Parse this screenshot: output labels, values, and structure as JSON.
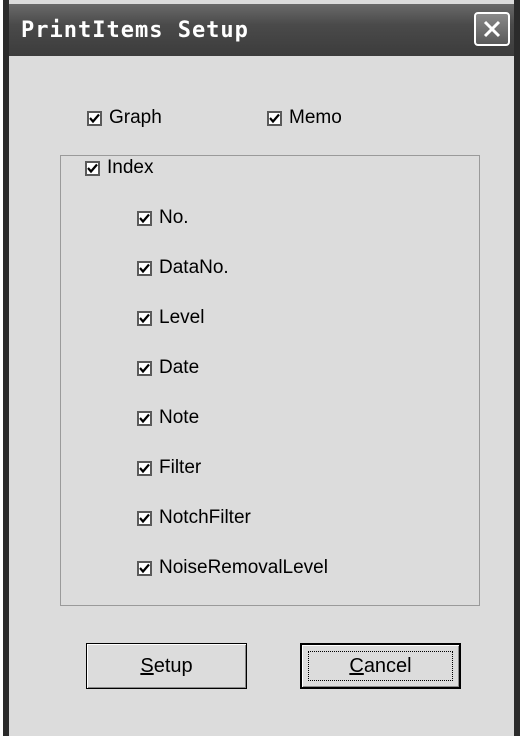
{
  "window": {
    "title": "PrintItems Setup"
  },
  "checkboxes": {
    "graph": {
      "label": "Graph",
      "checked": true
    },
    "memo": {
      "label": "Memo",
      "checked": true
    },
    "index": {
      "label": "Index",
      "checked": true
    }
  },
  "index_items": [
    {
      "label": "No.",
      "checked": true
    },
    {
      "label": "DataNo.",
      "checked": true
    },
    {
      "label": "Level",
      "checked": true
    },
    {
      "label": "Date",
      "checked": true
    },
    {
      "label": "Note",
      "checked": true
    },
    {
      "label": "Filter",
      "checked": true
    },
    {
      "label": "NotchFilter",
      "checked": true
    },
    {
      "label": "NoiseRemovalLevel",
      "checked": true
    }
  ],
  "buttons": {
    "setup": {
      "accel": "S",
      "rest": "etup"
    },
    "cancel": {
      "accel": "C",
      "rest": "ancel"
    }
  }
}
